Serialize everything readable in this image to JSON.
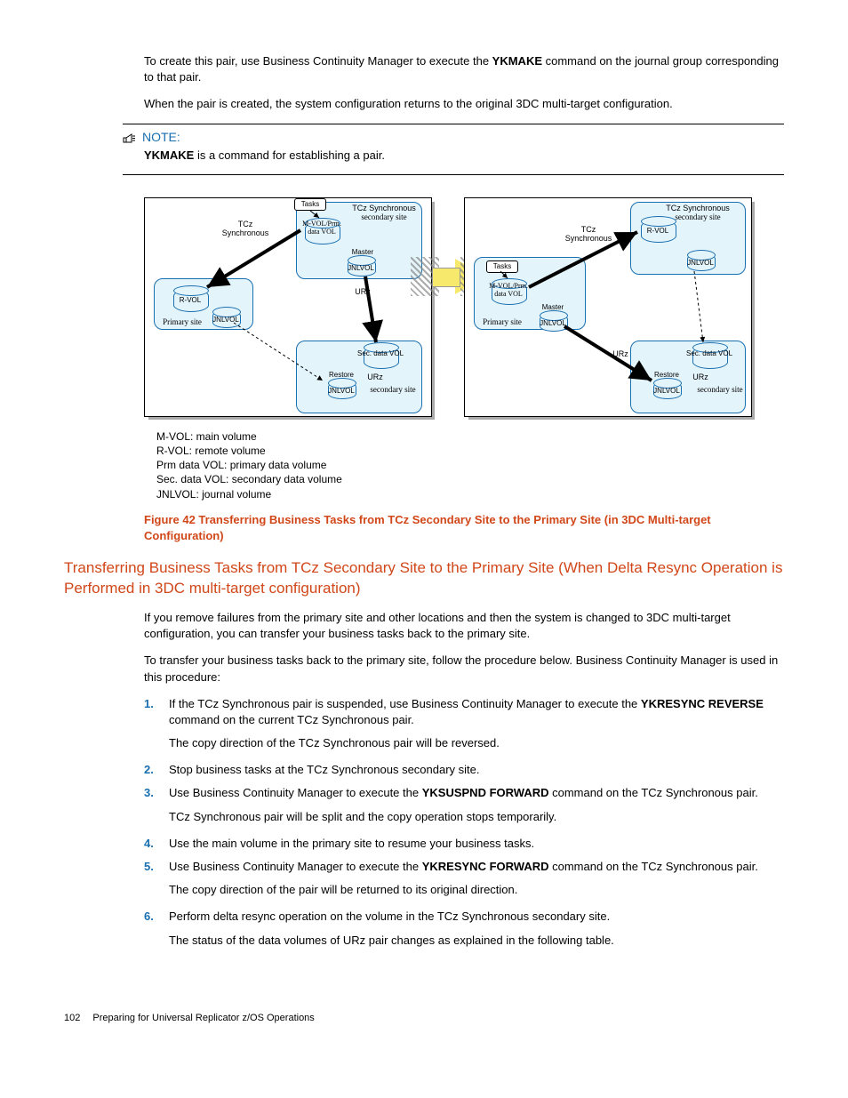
{
  "intro": {
    "p1a": "To create this pair, use Business Continuity Manager to execute the ",
    "p1_cmd": "YKMAKE",
    "p1b": " command on the journal group corresponding to that pair.",
    "p2": "When the pair is created, the system configuration returns to the original 3DC multi-target configuration."
  },
  "note": {
    "label": "NOTE:",
    "boldcmd": "YKMAKE",
    "text": " is a command for establishing a pair."
  },
  "diagram": {
    "tasks": "Tasks",
    "tcz_sync": "TCz Synchronous",
    "tcz_sync_sec_site": "TCz Synchronous secondary site",
    "mvol_prm": "M-VOL/Prm. data VOL",
    "rvol": "R-VOL",
    "master": "Master",
    "jnlvol": "JNLVOL",
    "primary_site": "Primary site",
    "urz": "URz",
    "sec_data_vol": "Sec. data VOL",
    "restore": "Restore",
    "urz_secondary_site": "URz secondary site"
  },
  "legend": {
    "l1": "M-VOL: main volume",
    "l2": "R-VOL: remote volume",
    "l3": "Prm data VOL: primary data volume",
    "l4": "Sec. data VOL: secondary data volume",
    "l5": "JNLVOL: journal volume"
  },
  "figure_caption": "Figure 42 Transferring Business Tasks from TCz Secondary Site to the Primary Site (in 3DC Multi-target Configuration)",
  "section_heading": "Transferring Business Tasks from TCz Secondary Site to the Primary Site (When Delta Resync Operation is Performed in 3DC multi-target configuration)",
  "body": {
    "p1": "If you remove failures from the primary site and other locations and then the system is changed to 3DC multi-target configuration, you can transfer your business tasks back to the primary site.",
    "p2": "To transfer your business tasks back to the primary site, follow the procedure below. Business Continuity Manager is used in this procedure:"
  },
  "steps": [
    {
      "text_a": "If the TCz Synchronous pair is suspended, use Business Continuity Manager to execute the ",
      "cmd": "YKRESYNC REVERSE",
      "text_b": " command on the current TCz Synchronous pair.",
      "follow": "The copy direction of the TCz Synchronous pair will be reversed."
    },
    {
      "text_a": "Stop business tasks at the TCz Synchronous secondary site.",
      "cmd": "",
      "text_b": "",
      "follow": ""
    },
    {
      "text_a": "Use Business Continuity Manager to execute the ",
      "cmd": "YKSUSPND FORWARD",
      "text_b": " command on the TCz Synchronous pair.",
      "follow": "TCz Synchronous pair will be split and the copy operation stops temporarily."
    },
    {
      "text_a": "Use the main volume in the primary site to resume your business tasks.",
      "cmd": "",
      "text_b": "",
      "follow": ""
    },
    {
      "text_a": "Use Business Continuity Manager to execute the ",
      "cmd": "YKRESYNC FORWARD",
      "text_b": " command on the TCz Synchronous pair.",
      "follow": "The copy direction of the pair will be returned to its original direction."
    },
    {
      "text_a": "Perform delta resync operation on the volume in the TCz Synchronous secondary site.",
      "cmd": "",
      "text_b": "",
      "follow": "The status of the data volumes of URz pair changes as explained in the following table."
    }
  ],
  "footer": {
    "page": "102",
    "title": "Preparing for Universal Replicator z/OS Operations"
  }
}
